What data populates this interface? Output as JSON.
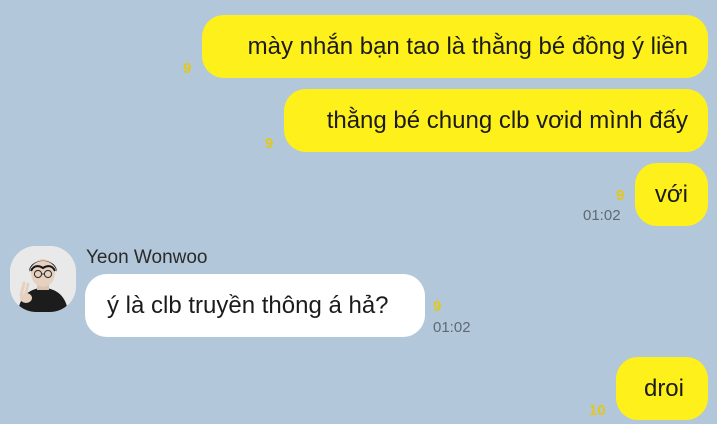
{
  "messages": [
    {
      "id": "m1",
      "direction": "outgoing",
      "text": "mày nhắn bạn tao là thằng bé đồng ý liền",
      "unread": "9",
      "time": ""
    },
    {
      "id": "m2",
      "direction": "outgoing",
      "text": "thằng bé chung clb vơid mình đấy",
      "unread": "9",
      "time": ""
    },
    {
      "id": "m3",
      "direction": "outgoing",
      "text": "với",
      "unread": "9",
      "time": "01:02"
    },
    {
      "id": "m4",
      "direction": "incoming",
      "sender": "Yeon Wonwoo",
      "text": "ý là clb truyền thông á hả?",
      "unread": "9",
      "time": "01:02"
    },
    {
      "id": "m5",
      "direction": "outgoing",
      "text": "droi",
      "unread": "10",
      "time": ""
    }
  ],
  "colors": {
    "background": "#b2c7d9",
    "outgoing_bubble": "#fef01b",
    "incoming_bubble": "#ffffff",
    "unread_count": "#e2c81a",
    "timestamp": "#5d6a75"
  },
  "icons": {
    "avatar": "profile-photo"
  }
}
